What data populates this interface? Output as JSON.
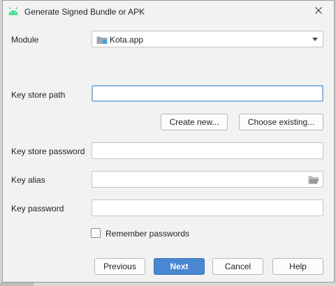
{
  "window": {
    "title": "Generate Signed Bundle or APK",
    "close_glyph": "✕"
  },
  "form": {
    "module_label": "Module",
    "module_value": "Kota.app",
    "keystore_path_label": "Key store path",
    "keystore_path_value": "",
    "create_new_label": "Create new...",
    "choose_existing_label": "Choose existing...",
    "keystore_password_label": "Key store password",
    "keystore_password_value": "",
    "key_alias_label": "Key alias",
    "key_alias_value": "",
    "key_password_label": "Key password",
    "key_password_value": "",
    "remember_passwords_label": "Remember passwords",
    "remember_passwords_checked": false
  },
  "footer": {
    "previous_label": "Previous",
    "next_label": "Next",
    "cancel_label": "Cancel",
    "help_label": "Help"
  },
  "colors": {
    "accent": "#4a87d2",
    "android_green": "#3ddc84",
    "focus_ring": "#8fb5e2"
  },
  "icons": {
    "app": "android-icon",
    "close": "close-icon",
    "module": "module-folder-icon",
    "dropdown": "chevron-down-icon",
    "browse": "folder-browse-icon"
  }
}
